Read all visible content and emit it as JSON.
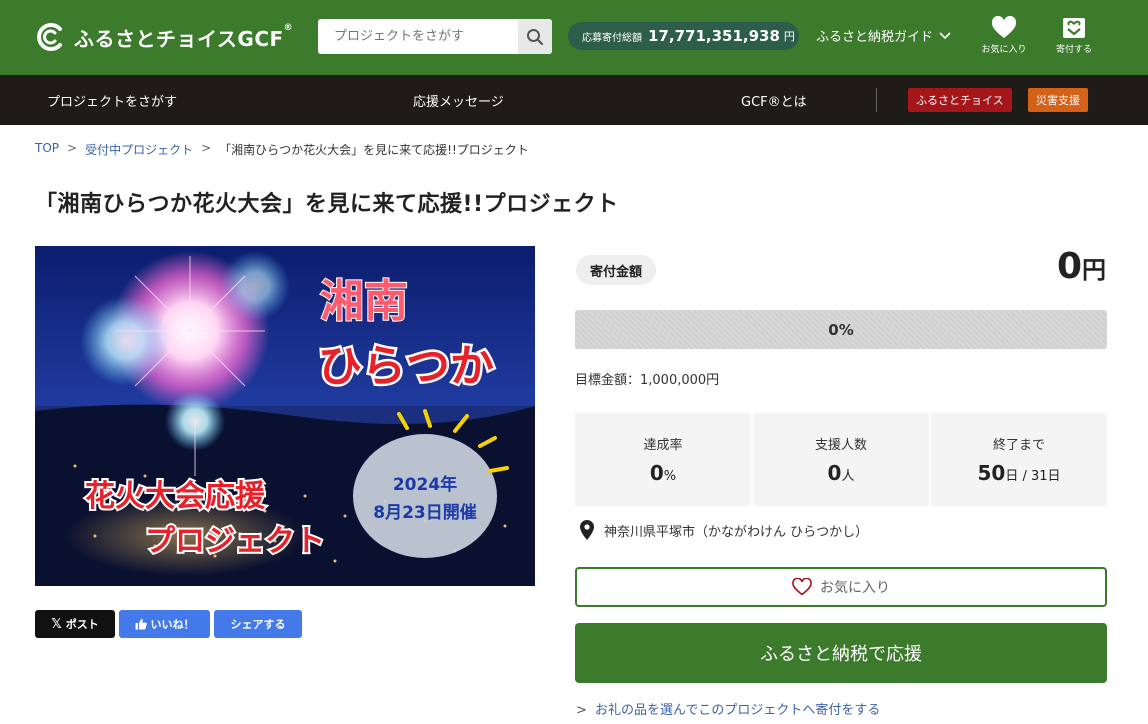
{
  "header": {
    "logo_text": "ふるさとチョイスGCF",
    "logo_reg": "®",
    "search_placeholder": "プロジェクトをさがす",
    "total_label": "応募寄付総額",
    "total_value": "17,771,351,938",
    "total_unit": "円",
    "guide_label": "ふるさと納税ガイド",
    "favorites_label": "お気に入り",
    "donate_label": "寄付する"
  },
  "nav": {
    "items": [
      "プロジェクトをさがす",
      "応援メッセージ",
      "GCF®とは"
    ],
    "badges": [
      {
        "label": "ふるさとチョイス",
        "color": "#a4161a"
      },
      {
        "label": "災害支援",
        "color": "#d4601a"
      }
    ]
  },
  "breadcrumb": {
    "top": "TOP",
    "sep": ">",
    "category": "受付中プロジェクト",
    "current": "「湘南ひらつか花火大会」を見に来て応援!!プロジェクト"
  },
  "project": {
    "title": "「湘南ひらつか花火大会」を見に来て応援!!プロジェクト",
    "hero": {
      "line1": "湘南",
      "line2": "ひらつか",
      "line3": "花火大会応援",
      "line4": "プロジェクト",
      "bubble_line1": "2024年",
      "bubble_line2": "8月23日開催"
    }
  },
  "share": {
    "x_label": "ポスト",
    "like_label": "いいね！",
    "share_label": "シェアする"
  },
  "donation": {
    "tag": "寄付金額",
    "amount": "0",
    "amount_unit": "円",
    "progress_text": "0%",
    "progress_fraction": 0,
    "goal_label": "目標金額：1,000,000円",
    "stats": [
      {
        "label": "達成率",
        "value": "0",
        "unit": "%"
      },
      {
        "label": "支援人数",
        "value": "0",
        "unit": "人"
      },
      {
        "label": "終了まで",
        "value": "50",
        "unit": "日 / 31日"
      }
    ],
    "location": "神奈川県平塚市（かながわけん ひらつかし）",
    "favorite_button": "お気に入り",
    "donate_button": "ふるさと納税で応援",
    "gift_link": "お礼の品を選んでこのプロジェクトへ寄付をする",
    "gift_link_prefix": ">"
  },
  "colors": {
    "brand_green": "#3c7a2c",
    "nav_dark": "#1f1c17",
    "link_blue": "#3a63a8",
    "total_pill": "#2d5e4b"
  }
}
